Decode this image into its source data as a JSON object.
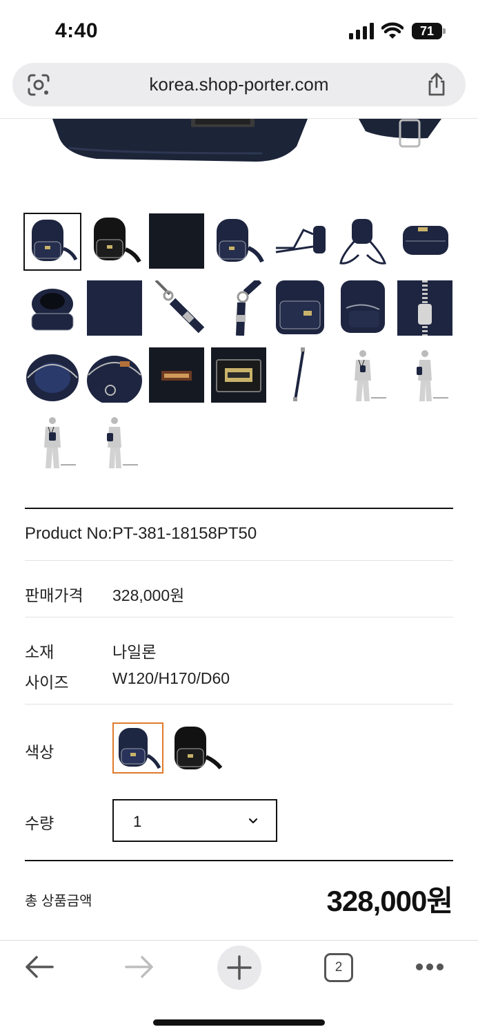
{
  "status_bar": {
    "time": "4:40",
    "battery": "71"
  },
  "browser": {
    "url": "korea.shop-porter.com",
    "tab_count": "2"
  },
  "product": {
    "product_no": "Product No:PT-381-18158PT50",
    "price_label": "판매가격",
    "price_value": "328,000원",
    "material_label": "소재",
    "material_value": "나일론",
    "size_label": "사이즈",
    "size_value": "W120/H170/D60",
    "color_label": "색상",
    "colors": [
      {
        "name": "navy",
        "hex": "#1e2742",
        "selected": true
      },
      {
        "name": "black",
        "hex": "#121212",
        "selected": false
      }
    ],
    "qty_label": "수량",
    "qty_value": "1",
    "total_label": "총 상품금액",
    "total_value": "328,000원"
  },
  "thumbnails": [
    "navy-backpack-front",
    "black-backpack-front",
    "black-fabric-closeup",
    "navy-backpack-angle",
    "navy-backpack-side",
    "navy-backpack-back",
    "navy-backpack-top",
    "navy-backpack-open",
    "navy-fabric-closeup",
    "strap-clip",
    "strap-clip-2",
    "front-pocket",
    "side-zipper",
    "zipper-closeup",
    "interior-open",
    "interior-pocket",
    "label-tag",
    "porter-logo-tag",
    "shoulder-strap",
    "model-front-1",
    "model-side-1",
    "model-front-2",
    "model-side-2"
  ],
  "colors": {
    "accent_selected": "#e07a2b",
    "navy": "#1e2742"
  }
}
